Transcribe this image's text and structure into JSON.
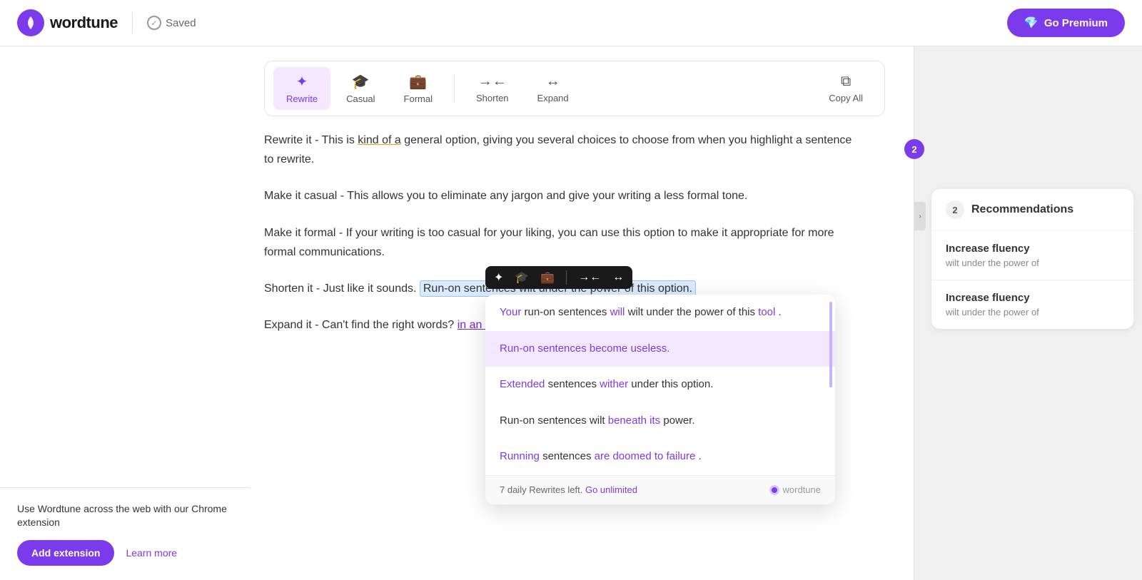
{
  "header": {
    "logo_text": "wordtune",
    "saved_label": "Saved",
    "premium_btn": "Go Premium"
  },
  "toolbar": {
    "items": [
      {
        "id": "rewrite",
        "label": "Rewrite",
        "icon": "✦",
        "active": true
      },
      {
        "id": "casual",
        "label": "Casual",
        "icon": "🎓",
        "active": false
      },
      {
        "id": "formal",
        "label": "Formal",
        "icon": "💼",
        "active": false
      },
      {
        "id": "shorten",
        "label": "Shorten",
        "icon": "→←",
        "active": false
      },
      {
        "id": "expand",
        "label": "Expand",
        "icon": "↔",
        "active": false
      }
    ],
    "copy_all_label": "Copy All"
  },
  "editor": {
    "paragraphs": [
      "Rewrite it - This is kind of a general option, giving you several choices to choose from when you highlight a sentence to rewrite.",
      "Make it casual - This allows you to eliminate any jargon and give your writing a less formal tone.",
      "Make it formal - If your writing is too casual for your liking, you can use this option to make it appropriate for more formal communications.",
      "Shorten it - Just like it sounds.",
      "Expand it - Can't find the right words?"
    ],
    "highlighted_text": "Run-on sentences wilt under the power of this option.",
    "expand_suffix": "in an effort to make it clearer"
  },
  "inline_toolbar": {
    "icons": [
      "✦",
      "🎓",
      "💼",
      "→←",
      "↔"
    ]
  },
  "rewrite_dropdown": {
    "options": [
      {
        "id": 1,
        "text_parts": [
          {
            "text": "Your",
            "style": "purple"
          },
          {
            "text": " run-on sentences ",
            "style": "normal"
          },
          {
            "text": "will",
            "style": "purple"
          },
          {
            "text": " wilt under the power of this ",
            "style": "normal"
          },
          {
            "text": "tool",
            "style": "purple"
          },
          {
            "text": ".",
            "style": "normal"
          }
        ],
        "highlighted": false
      },
      {
        "id": 2,
        "text_parts": [
          {
            "text": "Run-on sentences ",
            "style": "purple"
          },
          {
            "text": "become useless",
            "style": "purple"
          },
          {
            "text": ".",
            "style": "purple"
          }
        ],
        "highlighted": true
      },
      {
        "id": 3,
        "text_parts": [
          {
            "text": "Extended",
            "style": "purple"
          },
          {
            "text": " sentences ",
            "style": "normal"
          },
          {
            "text": "wither",
            "style": "purple"
          },
          {
            "text": " under this option.",
            "style": "normal"
          }
        ],
        "highlighted": false
      },
      {
        "id": 4,
        "text_parts": [
          {
            "text": "Run-on sentences wilt ",
            "style": "normal"
          },
          {
            "text": "beneath its",
            "style": "purple"
          },
          {
            "text": " power.",
            "style": "normal"
          }
        ],
        "highlighted": false
      },
      {
        "id": 5,
        "text_parts": [
          {
            "text": "Running",
            "style": "purple"
          },
          {
            "text": " sentences ",
            "style": "normal"
          },
          {
            "text": "are doomed to failure",
            "style": "purple"
          },
          {
            "text": ".",
            "style": "normal"
          }
        ],
        "highlighted": false
      }
    ],
    "footer": {
      "rewrites_left": "7 daily Rewrites left.",
      "go_unlimited": "Go unlimited",
      "wordtune_label": "wordtune"
    }
  },
  "recommendations": {
    "badge_count": "2",
    "header": "Recommendations",
    "header_badge": "2",
    "items": [
      {
        "title": "Increase fluency",
        "subtitle": "wilt under the power of"
      },
      {
        "title": "Increase fluency",
        "subtitle": "wilt under the power of"
      }
    ]
  },
  "extension_banner": {
    "text": "Use Wordtune across the web with our Chrome extension",
    "add_btn": "Add extension",
    "learn_more": "Learn more"
  }
}
